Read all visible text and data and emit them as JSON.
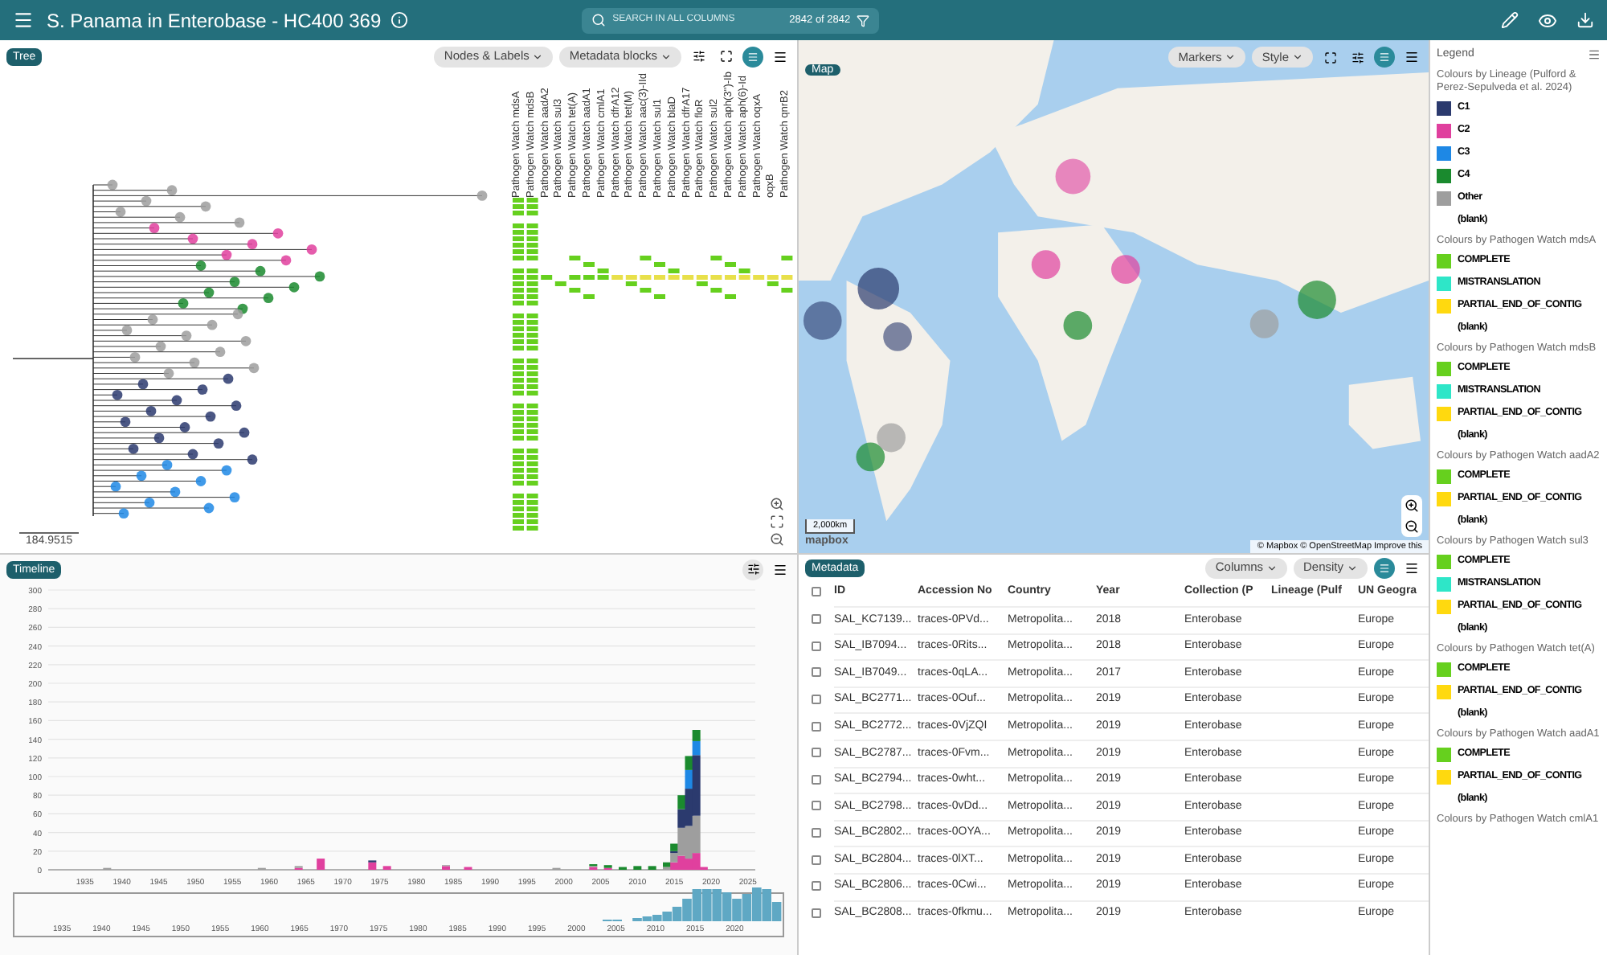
{
  "header": {
    "title": "S. Panama in Enterobase - HC400 369",
    "search": {
      "placeholder": "SEARCH IN ALL COLUMNS",
      "count": "2842 of 2842"
    }
  },
  "tree": {
    "label": "Tree",
    "buttons": [
      "Nodes & Labels",
      "Metadata blocks"
    ],
    "scale": "184.9515",
    "columns": [
      "Pathogen Watch mdsA",
      "Pathogen Watch mdsB",
      "Pathogen Watch aadA2",
      "Pathogen Watch sul3",
      "Pathogen Watch tet(A)",
      "Pathogen Watch aadA1",
      "Pathogen Watch cmlA1",
      "Pathogen Watch dfrA12",
      "Pathogen Watch tet(M)",
      "Pathogen Watch aac(3)-IId",
      "Pathogen Watch sul1",
      "Pathogen Watch blaD",
      "Pathogen Watch dfrA17",
      "Pathogen Watch floR",
      "Pathogen Watch sul2",
      "Pathogen Watch aph(3'')-Ib",
      "Pathogen Watch aph(6)-Id",
      "Pathogen Watch oqxA",
      "oqxB",
      "Pathogen Watch qnrB2"
    ]
  },
  "map": {
    "label": "Map",
    "buttons": [
      "Markers",
      "Style"
    ],
    "scale": "2,000km",
    "logo": "mapbox",
    "attribution": "© Mapbox © OpenStreetMap  Improve this"
  },
  "timeline": {
    "label": "Timeline",
    "chart_data": {
      "type": "bar",
      "stacked": true,
      "x": [
        1938,
        1959,
        1964,
        1967,
        1974,
        1976,
        1984,
        1987,
        1999,
        2004,
        2006,
        2008,
        2010,
        2012,
        2014,
        2015,
        2016,
        2017,
        2018,
        2019
      ],
      "series": [
        {
          "color": "#e0409e",
          "values": [
            0,
            0,
            2,
            12,
            8,
            4,
            4,
            3,
            0,
            3,
            2,
            0,
            0,
            0,
            0,
            8,
            15,
            12,
            18,
            3
          ]
        },
        {
          "color": "#9e9e9e",
          "values": [
            2,
            2,
            2,
            0,
            0,
            0,
            1,
            0,
            2,
            1,
            0,
            0,
            0,
            0,
            3,
            10,
            30,
            35,
            40,
            0
          ]
        },
        {
          "color": "#2b3a6e",
          "values": [
            0,
            0,
            0,
            0,
            2,
            0,
            0,
            0,
            0,
            0,
            0,
            0,
            0,
            0,
            0,
            2,
            20,
            40,
            65,
            0
          ]
        },
        {
          "color": "#1e88e5",
          "values": [
            0,
            0,
            0,
            0,
            0,
            0,
            0,
            0,
            0,
            0,
            0,
            0,
            0,
            0,
            0,
            0,
            0,
            20,
            15,
            0
          ]
        },
        {
          "color": "#1a8a2e",
          "values": [
            0,
            0,
            0,
            0,
            0,
            0,
            0,
            0,
            0,
            2,
            3,
            3,
            4,
            4,
            5,
            8,
            15,
            15,
            12,
            0
          ]
        }
      ],
      "xticks": [
        1935,
        1940,
        1945,
        1950,
        1955,
        1960,
        1965,
        1970,
        1975,
        1980,
        1985,
        1990,
        1995,
        2000,
        2005,
        2010,
        2015,
        2020,
        2025
      ],
      "xlim": [
        1930,
        2026
      ],
      "grid": true,
      "yticks": [
        0,
        20,
        40,
        60,
        80,
        100,
        120,
        140,
        160,
        180,
        200,
        220,
        240,
        260,
        280,
        300
      ],
      "ylim": [
        0,
        300
      ]
    },
    "overview_ticks": [
      "1935",
      "1940",
      "1945",
      "1950",
      "1955",
      "1960",
      "1965",
      "1970",
      "1975",
      "1980",
      "1985",
      "1990",
      "1995",
      "2000",
      "2005",
      "2010",
      "2015",
      "2020"
    ]
  },
  "metadata": {
    "label": "Metadata",
    "buttons": [
      "Columns",
      "Density"
    ],
    "all_checked": false,
    "columns": [
      "ID",
      "Accession No",
      "Country",
      "Year",
      "Collection (P",
      "Lineage (Pulf",
      "UN Geogra"
    ],
    "rows": [
      {
        "checked": false,
        "cells": [
          "SAL_KC7139...",
          "traces-0PVd...",
          "Metropolita...",
          "2018",
          "Enterobase",
          "",
          "Europe"
        ]
      },
      {
        "checked": false,
        "cells": [
          "SAL_IB7094...",
          "traces-0Rits...",
          "Metropolita...",
          "2018",
          "Enterobase",
          "",
          "Europe"
        ]
      },
      {
        "checked": false,
        "cells": [
          "SAL_IB7049...",
          "traces-0qLA...",
          "Metropolita...",
          "2017",
          "Enterobase",
          "",
          "Europe"
        ]
      },
      {
        "checked": false,
        "cells": [
          "SAL_BC2771...",
          "traces-0Ouf...",
          "Metropolita...",
          "2019",
          "Enterobase",
          "",
          "Europe"
        ]
      },
      {
        "checked": false,
        "cells": [
          "SAL_BC2772...",
          "traces-0VjZQI",
          "Metropolita...",
          "2019",
          "Enterobase",
          "",
          "Europe"
        ]
      },
      {
        "checked": false,
        "cells": [
          "SAL_BC2787...",
          "traces-0Fvm...",
          "Metropolita...",
          "2019",
          "Enterobase",
          "",
          "Europe"
        ]
      },
      {
        "checked": false,
        "cells": [
          "SAL_BC2794...",
          "traces-0wht...",
          "Metropolita...",
          "2019",
          "Enterobase",
          "",
          "Europe"
        ]
      },
      {
        "checked": false,
        "cells": [
          "SAL_BC2798...",
          "traces-0vDd...",
          "Metropolita...",
          "2019",
          "Enterobase",
          "",
          "Europe"
        ]
      },
      {
        "checked": false,
        "cells": [
          "SAL_BC2802...",
          "traces-0OYA...",
          "Metropolita...",
          "2019",
          "Enterobase",
          "",
          "Europe"
        ]
      },
      {
        "checked": false,
        "cells": [
          "SAL_BC2804...",
          "traces-0lXT...",
          "Metropolita...",
          "2019",
          "Enterobase",
          "",
          "Europe"
        ]
      },
      {
        "checked": false,
        "cells": [
          "SAL_BC2806...",
          "traces-0Cwi...",
          "Metropolita...",
          "2019",
          "Enterobase",
          "",
          "Europe"
        ]
      },
      {
        "checked": false,
        "cells": [
          "SAL_BC2808...",
          "traces-0fkmu...",
          "Metropolita...",
          "2019",
          "Enterobase",
          "",
          "Europe"
        ]
      }
    ]
  },
  "legend": {
    "title": "Legend",
    "sections": [
      {
        "title": "Colours by Lineage (Pulford & Perez-Sepulveda et al. 2024)",
        "items": [
          {
            "label": "C1",
            "color": "#2b3a6e"
          },
          {
            "label": "C2",
            "color": "#e0409e"
          },
          {
            "label": "C3",
            "color": "#1e88e5"
          },
          {
            "label": "C4",
            "color": "#1a8a2e"
          },
          {
            "label": "Other",
            "color": "#9e9e9e"
          },
          {
            "label": "(blank)"
          }
        ]
      },
      {
        "title": "Colours by Pathogen Watch mdsA",
        "items": [
          {
            "label": "COMPLETE",
            "color": "#66d01e"
          },
          {
            "label": "MISTRANSLATION",
            "color": "#2ee6c8"
          },
          {
            "label": "PARTIAL_END_OF_CONTIG",
            "color": "#ffd90f"
          },
          {
            "label": "(blank)"
          }
        ]
      },
      {
        "title": "Colours by Pathogen Watch mdsB",
        "items": [
          {
            "label": "COMPLETE",
            "color": "#66d01e"
          },
          {
            "label": "MISTRANSLATION",
            "color": "#2ee6c8"
          },
          {
            "label": "PARTIAL_END_OF_CONTIG",
            "color": "#ffd90f"
          },
          {
            "label": "(blank)"
          }
        ]
      },
      {
        "title": "Colours by Pathogen Watch aadA2",
        "items": [
          {
            "label": "COMPLETE",
            "color": "#66d01e"
          },
          {
            "label": "PARTIAL_END_OF_CONTIG",
            "color": "#ffd90f"
          },
          {
            "label": "(blank)"
          }
        ]
      },
      {
        "title": "Colours by Pathogen Watch sul3",
        "items": [
          {
            "label": "COMPLETE",
            "color": "#66d01e"
          },
          {
            "label": "MISTRANSLATION",
            "color": "#2ee6c8"
          },
          {
            "label": "PARTIAL_END_OF_CONTIG",
            "color": "#ffd90f"
          },
          {
            "label": "(blank)"
          }
        ]
      },
      {
        "title": "Colours by Pathogen Watch tet(A)",
        "items": [
          {
            "label": "COMPLETE",
            "color": "#66d01e"
          },
          {
            "label": "PARTIAL_END_OF_CONTIG",
            "color": "#ffd90f"
          },
          {
            "label": "(blank)"
          }
        ]
      },
      {
        "title": "Colours by Pathogen Watch aadA1",
        "items": [
          {
            "label": "COMPLETE",
            "color": "#66d01e"
          },
          {
            "label": "PARTIAL_END_OF_CONTIG",
            "color": "#ffd90f"
          },
          {
            "label": "(blank)"
          }
        ]
      },
      {
        "title": "Colours by Pathogen Watch cmlA1"
      }
    ]
  }
}
